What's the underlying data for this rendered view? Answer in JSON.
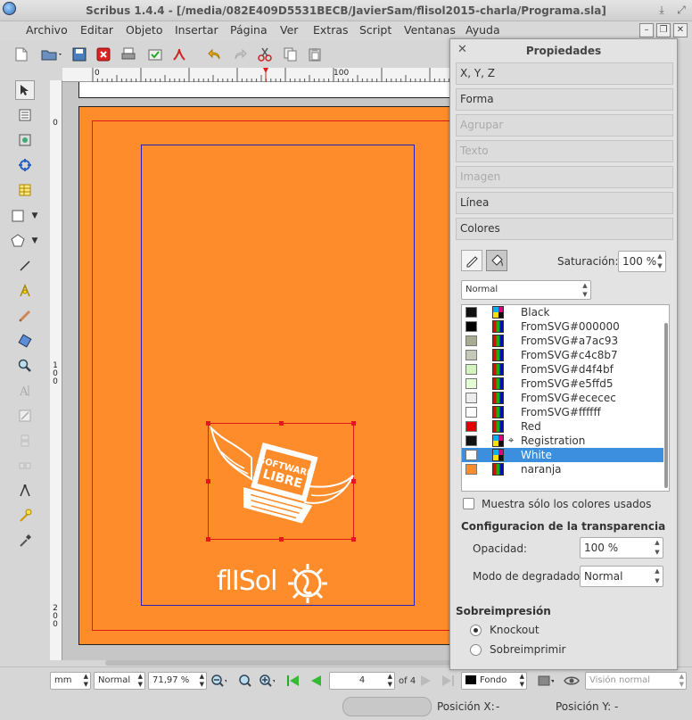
{
  "window": {
    "title": "Scribus 1.4.4 - [/media/082E409D5531BECB/JavierSam/flisol2015-charla/Programa.sla]"
  },
  "menu": [
    "Archivo",
    "Editar",
    "Objeto",
    "Insertar",
    "Página",
    "Ver",
    "Extras",
    "Script",
    "Ventanas",
    "Ayuda"
  ],
  "rulers": {
    "h_labels": [
      "0",
      "100"
    ],
    "v_labels": [
      {
        "chars": [
          "0"
        ]
      },
      {
        "chars": [
          "1",
          "0",
          "0"
        ]
      },
      {
        "chars": [
          "2",
          "0",
          "0"
        ]
      }
    ]
  },
  "document": {
    "page_color": "#ff8c2b",
    "bleed_color": "#e01818",
    "margin_color": "#2222bb",
    "logo_text": "SOFTWARE LIBRE",
    "event_text": "flISol"
  },
  "statusbar": {
    "unit": "mm",
    "mode": "Normal",
    "zoom": "71,97 %",
    "page": "4",
    "page_of": "of 4",
    "layer": "Fondo",
    "view": "Visión normal"
  },
  "posbar": {
    "x_label": "Posición X:",
    "x_value": "-",
    "y_label": "Posición Y:",
    "y_value": "-"
  },
  "panel": {
    "title": "Propiedades",
    "sections": [
      {
        "label": "X, Y, Z",
        "enabled": true
      },
      {
        "label": "Forma",
        "enabled": true
      },
      {
        "label": "Agrupar",
        "enabled": false
      },
      {
        "label": "Texto",
        "enabled": false
      },
      {
        "label": "Imagen",
        "enabled": false
      },
      {
        "label": "Línea",
        "enabled": true
      },
      {
        "label": "Colores",
        "enabled": true
      }
    ],
    "saturation_label": "Saturación:",
    "saturation_value": "100 %",
    "gradient_mode": "Normal",
    "colors": [
      {
        "name": "Black",
        "swatch": "#111111",
        "kind": "cmyk"
      },
      {
        "name": "FromSVG#000000",
        "swatch": "#000000",
        "kind": "rgb"
      },
      {
        "name": "FromSVG#a7ac93",
        "swatch": "#a7ac93",
        "kind": "rgb"
      },
      {
        "name": "FromSVG#c4c8b7",
        "swatch": "#c4c8b7",
        "kind": "rgb"
      },
      {
        "name": "FromSVG#d4f4bf",
        "swatch": "#d4f4bf",
        "kind": "rgb"
      },
      {
        "name": "FromSVG#e5ffd5",
        "swatch": "#e5ffd5",
        "kind": "rgb"
      },
      {
        "name": "FromSVG#ececec",
        "swatch": "#ececec",
        "kind": "rgb"
      },
      {
        "name": "FromSVG#ffffff",
        "swatch": "#ffffff",
        "kind": "rgb"
      },
      {
        "name": "Red",
        "swatch": "#e00000",
        "kind": "rgb"
      },
      {
        "name": "Registration",
        "swatch": "#111111",
        "kind": "registration"
      },
      {
        "name": "White",
        "swatch": "#ffffff",
        "kind": "cmyk",
        "selected": true
      },
      {
        "name": "naranja",
        "swatch": "#ff8c2b",
        "kind": "rgb"
      }
    ],
    "show_used_label": "Muestra sólo los colores usados",
    "transparency_heading": "Configuracion de la transparencia",
    "opacity_label": "Opacidad:",
    "opacity_value": "100 %",
    "blend_label": "Modo de degradado:",
    "blend_value": "Normal",
    "overprint_heading": "Sobreimpresión",
    "knockout_label": "Knockout",
    "overprint_label": "Sobreimprimir"
  }
}
